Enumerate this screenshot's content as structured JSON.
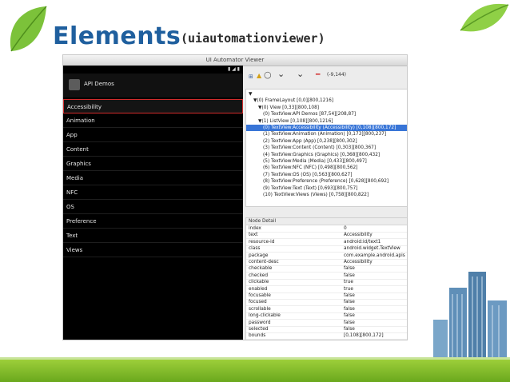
{
  "slide": {
    "title": "Elements",
    "subtitle": "(uiautomationviewer)"
  },
  "window": {
    "title": "UI Automator Viewer"
  },
  "device": {
    "app_title": "API Demos",
    "items": [
      {
        "label": "Accessibility",
        "selected": true
      },
      {
        "label": "Animation"
      },
      {
        "label": "App"
      },
      {
        "label": "Content"
      },
      {
        "label": "Graphics"
      },
      {
        "label": "Media"
      },
      {
        "label": "NFC"
      },
      {
        "label": "OS"
      },
      {
        "label": "Preference"
      },
      {
        "label": "Text"
      },
      {
        "label": "Views"
      }
    ]
  },
  "toolbar": {
    "coordinates": "(-9,144)"
  },
  "tree": {
    "lines": [
      {
        "text": "▼",
        "depth": 0
      },
      {
        "text": "▼(0) FrameLayout [0,0][800,1216]",
        "depth": 1
      },
      {
        "text": "▼(0) View [0,33][800,108]",
        "depth": 2
      },
      {
        "text": "(0) TextView:API Demos [87,54][208,87]",
        "depth": 3
      },
      {
        "text": "▼(1) ListView [0,108][800,1216]",
        "depth": 2
      },
      {
        "text": "(0) TextView:Accessibility (Accessibility) [0,108][800,172]",
        "depth": 3,
        "selected": true
      },
      {
        "text": "(1) TextView:Animation (Animation) [0,173][800,237]",
        "depth": 3
      },
      {
        "text": "(2) TextView:App (App) [0,238][800,302]",
        "depth": 3
      },
      {
        "text": "(3) TextView:Content (Content) [0,303][800,367]",
        "depth": 3
      },
      {
        "text": "(4) TextView:Graphics (Graphics) [0,368][800,432]",
        "depth": 3
      },
      {
        "text": "(5) TextView:Media (Media) [0,433][800,497]",
        "depth": 3
      },
      {
        "text": "(6) TextView:NFC (NFC) [0,498][800,562]",
        "depth": 3
      },
      {
        "text": "(7) TextView:OS (OS) [0,563][800,627]",
        "depth": 3
      },
      {
        "text": "(8) TextView:Preference (Preference) [0,628][800,692]",
        "depth": 3
      },
      {
        "text": "(9) TextView:Text (Text) [0,693][800,757]",
        "depth": 3
      },
      {
        "text": "(10) TextView:Views (Views) [0,758][800,822]",
        "depth": 3
      }
    ]
  },
  "detail": {
    "header": "Node Detail",
    "rows": [
      {
        "key": "index",
        "value": "0"
      },
      {
        "key": "text",
        "value": "Accessibility"
      },
      {
        "key": "resource-id",
        "value": "android:id/text1"
      },
      {
        "key": "class",
        "value": "android.widget.TextView"
      },
      {
        "key": "package",
        "value": "com.example.android.apis"
      },
      {
        "key": "content-desc",
        "value": "Accessibility"
      },
      {
        "key": "checkable",
        "value": "false"
      },
      {
        "key": "checked",
        "value": "false"
      },
      {
        "key": "clickable",
        "value": "true"
      },
      {
        "key": "enabled",
        "value": "true"
      },
      {
        "key": "focusable",
        "value": "false"
      },
      {
        "key": "focused",
        "value": "false"
      },
      {
        "key": "scrollable",
        "value": "false"
      },
      {
        "key": "long-clickable",
        "value": "false"
      },
      {
        "key": "password",
        "value": "false"
      },
      {
        "key": "selected",
        "value": "false"
      },
      {
        "key": "bounds",
        "value": "[0,108][800,172]"
      }
    ]
  },
  "colors": {
    "title_blue": "#1f5f9e",
    "selection_blue": "#3875d7",
    "highlight_red": "#d12c2c",
    "footer_green": "#6aa81d"
  }
}
